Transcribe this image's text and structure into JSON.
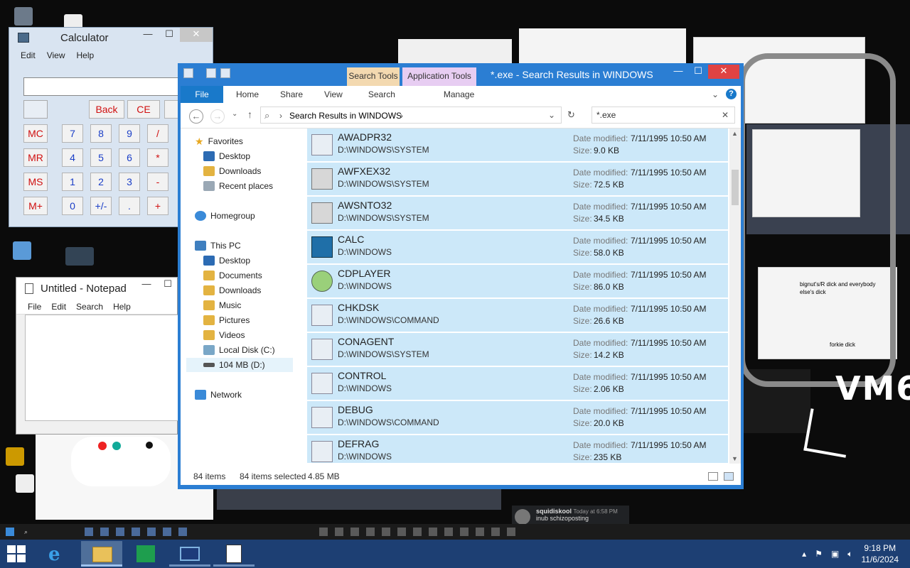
{
  "calculator": {
    "title": "Calculator",
    "menu": [
      "Edit",
      "View",
      "Help"
    ],
    "buttons": {
      "back": "Back",
      "ce": "CE",
      "mc": "MC",
      "mr": "MR",
      "ms": "MS",
      "mplus": "M+",
      "n7": "7",
      "n8": "8",
      "n9": "9",
      "div": "/",
      "n4": "4",
      "n5": "5",
      "n6": "6",
      "mul": "*",
      "n1": "1",
      "n2": "2",
      "n3": "3",
      "sub": "-",
      "n0": "0",
      "sign": "+/-",
      "dot": ".",
      "add": "+"
    }
  },
  "notepad": {
    "title": "Untitled - Notepad",
    "menu": [
      "File",
      "Edit",
      "Search",
      "Help"
    ]
  },
  "explorer": {
    "context_tabs": {
      "search": "Search Tools",
      "app": "Application Tools"
    },
    "title": "*.exe - Search Results in WINDOWS",
    "ribbon": {
      "file": "File",
      "tabs": [
        "Home",
        "Share",
        "View"
      ],
      "search": "Search",
      "manage": "Manage"
    },
    "address": {
      "crumb": "Search Results in WINDOWS"
    },
    "search": {
      "value": "*.exe"
    },
    "nav": {
      "favorites": "Favorites",
      "fav_items": [
        "Desktop",
        "Downloads",
        "Recent places"
      ],
      "homegroup": "Homegroup",
      "thispc": "This PC",
      "pc_items": [
        "Desktop",
        "Documents",
        "Downloads",
        "Music",
        "Pictures",
        "Videos",
        "Local Disk (C:)",
        "104 MB (D:)"
      ],
      "network": "Network"
    },
    "labels": {
      "date_modified": "Date modified:",
      "size": "Size:"
    },
    "files": [
      {
        "name": "AWADPR32",
        "path": "D:\\WINDOWS\\SYSTEM",
        "date": "7/11/1995 10:50 AM",
        "size": "9.0 KB"
      },
      {
        "name": "AWFXEX32",
        "path": "D:\\WINDOWS\\SYSTEM",
        "date": "7/11/1995 10:50 AM",
        "size": "72.5 KB"
      },
      {
        "name": "AWSNTO32",
        "path": "D:\\WINDOWS\\SYSTEM",
        "date": "7/11/1995 10:50 AM",
        "size": "34.5 KB"
      },
      {
        "name": "CALC",
        "path": "D:\\WINDOWS",
        "date": "7/11/1995 10:50 AM",
        "size": "58.0 KB"
      },
      {
        "name": "CDPLAYER",
        "path": "D:\\WINDOWS",
        "date": "7/11/1995 10:50 AM",
        "size": "86.0 KB"
      },
      {
        "name": "CHKDSK",
        "path": "D:\\WINDOWS\\COMMAND",
        "date": "7/11/1995 10:50 AM",
        "size": "26.6 KB"
      },
      {
        "name": "CONAGENT",
        "path": "D:\\WINDOWS\\SYSTEM",
        "date": "7/11/1995 10:50 AM",
        "size": "14.2 KB"
      },
      {
        "name": "CONTROL",
        "path": "D:\\WINDOWS",
        "date": "7/11/1995 10:50 AM",
        "size": "2.06 KB"
      },
      {
        "name": "DEBUG",
        "path": "D:\\WINDOWS\\COMMAND",
        "date": "7/11/1995 10:50 AM",
        "size": "20.0 KB"
      },
      {
        "name": "DEFRAG",
        "path": "D:\\WINDOWS",
        "date": "7/11/1995 10:50 AM",
        "size": "235 KB"
      }
    ],
    "status": {
      "count": "84 items",
      "selected": "84 items selected",
      "size": "4.85 MB"
    }
  },
  "desktop": {
    "drawing_text": [
      "bignut's/R dick and everybody else's dick",
      "forkie dick"
    ],
    "vm_label": "VM6",
    "chat": {
      "user": "squidiskool",
      "time": "Today at 6:58 PM",
      "message": "inub schizoposting"
    }
  },
  "taskbar": {
    "time": "9:18 PM",
    "date": "11/6/2024"
  }
}
